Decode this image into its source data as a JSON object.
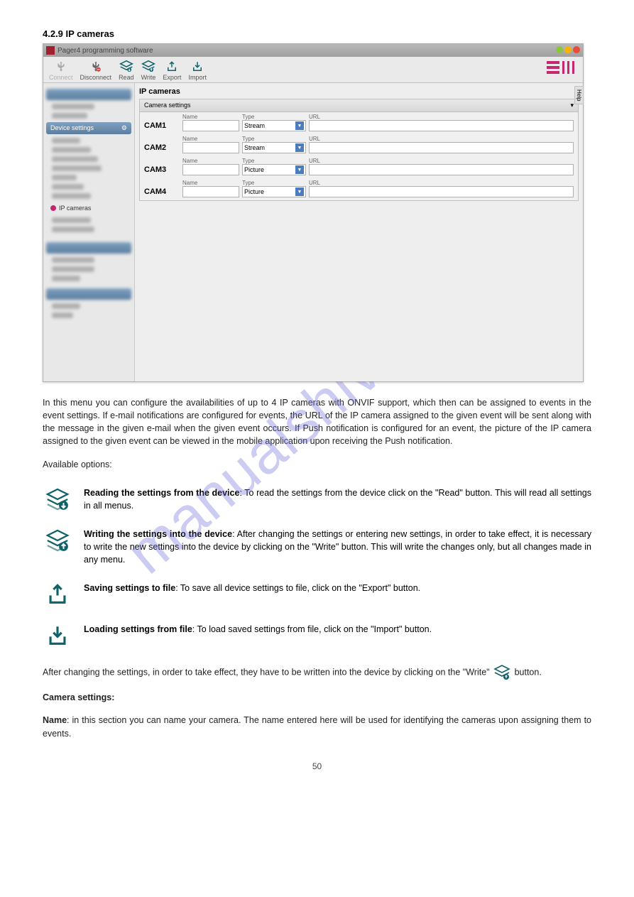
{
  "section": "4.2.9 IP cameras",
  "watermark": "manualshive.com",
  "page": "50",
  "app": {
    "title": "Pager4 programming software",
    "toolbar": {
      "connect": "Connect",
      "disconnect": "Disconnect",
      "read": "Read",
      "write": "Write",
      "export": "Export",
      "import": "Import"
    },
    "sidebar": {
      "device_settings": "Device settings",
      "ip_cameras": "IP cameras"
    },
    "help": "Help",
    "panel": {
      "title": "IP cameras",
      "box_title": "Camera settings"
    },
    "labels": {
      "name": "Name",
      "type": "Type",
      "url": "URL"
    },
    "cams": [
      {
        "id": "CAM1",
        "name": "",
        "type": "Stream",
        "url": ""
      },
      {
        "id": "CAM2",
        "name": "",
        "type": "Stream",
        "url": ""
      },
      {
        "id": "CAM3",
        "name": "",
        "type": "Picture",
        "url": ""
      },
      {
        "id": "CAM4",
        "name": "",
        "type": "Picture",
        "url": ""
      }
    ]
  },
  "text": {
    "p1": "In this menu you can configure the availabilities of up to 4 IP cameras with ONVIF support, which then can be assigned to events in the event settings. If e-mail notifications are configured for events, the URL of the IP camera assigned to the given event will be sent along with the message in the given e-mail when the given event occurs. If Push notification is configured for an event, the picture of the IP camera assigned to the given event can be viewed in the mobile application upon receiving the Push notification.",
    "p2": "Available options:",
    "read": {
      "label": "Reading the settings from the device",
      "body": ": To read the settings from the device click on the \"Read\" button. This will read all settings in all menus."
    },
    "write": {
      "label": "Writing the settings into the device",
      "body": ": After changing the settings or entering new settings, in order to take effect, it is necessary to write the new settings into the device by clicking on the \"Write\" button. This will write the changes only, but all changes made in any menu."
    },
    "export": {
      "label": "Saving settings to file",
      "body": ": To save all device settings to file, click on the \"Export\" button."
    },
    "import": {
      "label": "Loading settings from file",
      "body": ": To load saved settings from file, click on the \"Import\" button."
    },
    "hint1": "After changing the settings, in order to take effect, they have to be written into the device by clicking on the \"Write\"",
    "hint2": "button.",
    "camera_settings_title": "Camera settings:",
    "name": {
      "label": "Name",
      "body": ": in this section you can name your camera. The name entered here will be used for identifying the cameras upon assigning them to events."
    }
  }
}
